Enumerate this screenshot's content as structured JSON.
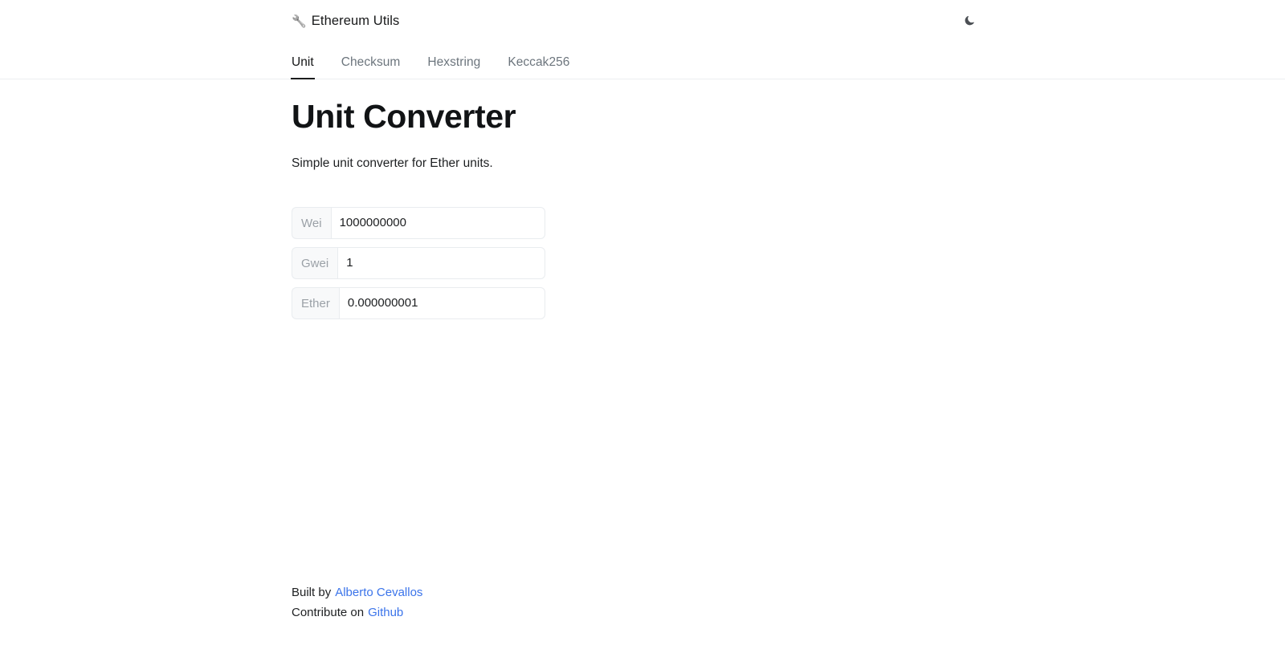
{
  "app": {
    "brand_emoji": "🔧",
    "brand_title": "Ethereum Utils",
    "theme_toggle_icon": "moon-icon"
  },
  "tabs": [
    {
      "label": "Unit",
      "active": true
    },
    {
      "label": "Checksum",
      "active": false
    },
    {
      "label": "Hexstring",
      "active": false
    },
    {
      "label": "Keccak256",
      "active": false
    }
  ],
  "main": {
    "title": "Unit Converter",
    "description": "Simple unit converter for Ether units.",
    "fields": [
      {
        "label": "Wei",
        "value": "1000000000",
        "placeholder": "Wei"
      },
      {
        "label": "Gwei",
        "value": "1",
        "placeholder": "Gwei"
      },
      {
        "label": "Ether",
        "value": "0.000000001",
        "placeholder": "Ether"
      }
    ]
  },
  "footer": {
    "built_by_text": "Built by",
    "author_link": "Alberto Cevallos",
    "contribute_text": "Contribute on",
    "repo_link": "Github"
  },
  "colors": {
    "link": "#3b74ea",
    "active_tab": "#141516",
    "inactive_tab": "#6c757d",
    "border": "#e9ecef",
    "label_bg": "#f8f9fa"
  }
}
